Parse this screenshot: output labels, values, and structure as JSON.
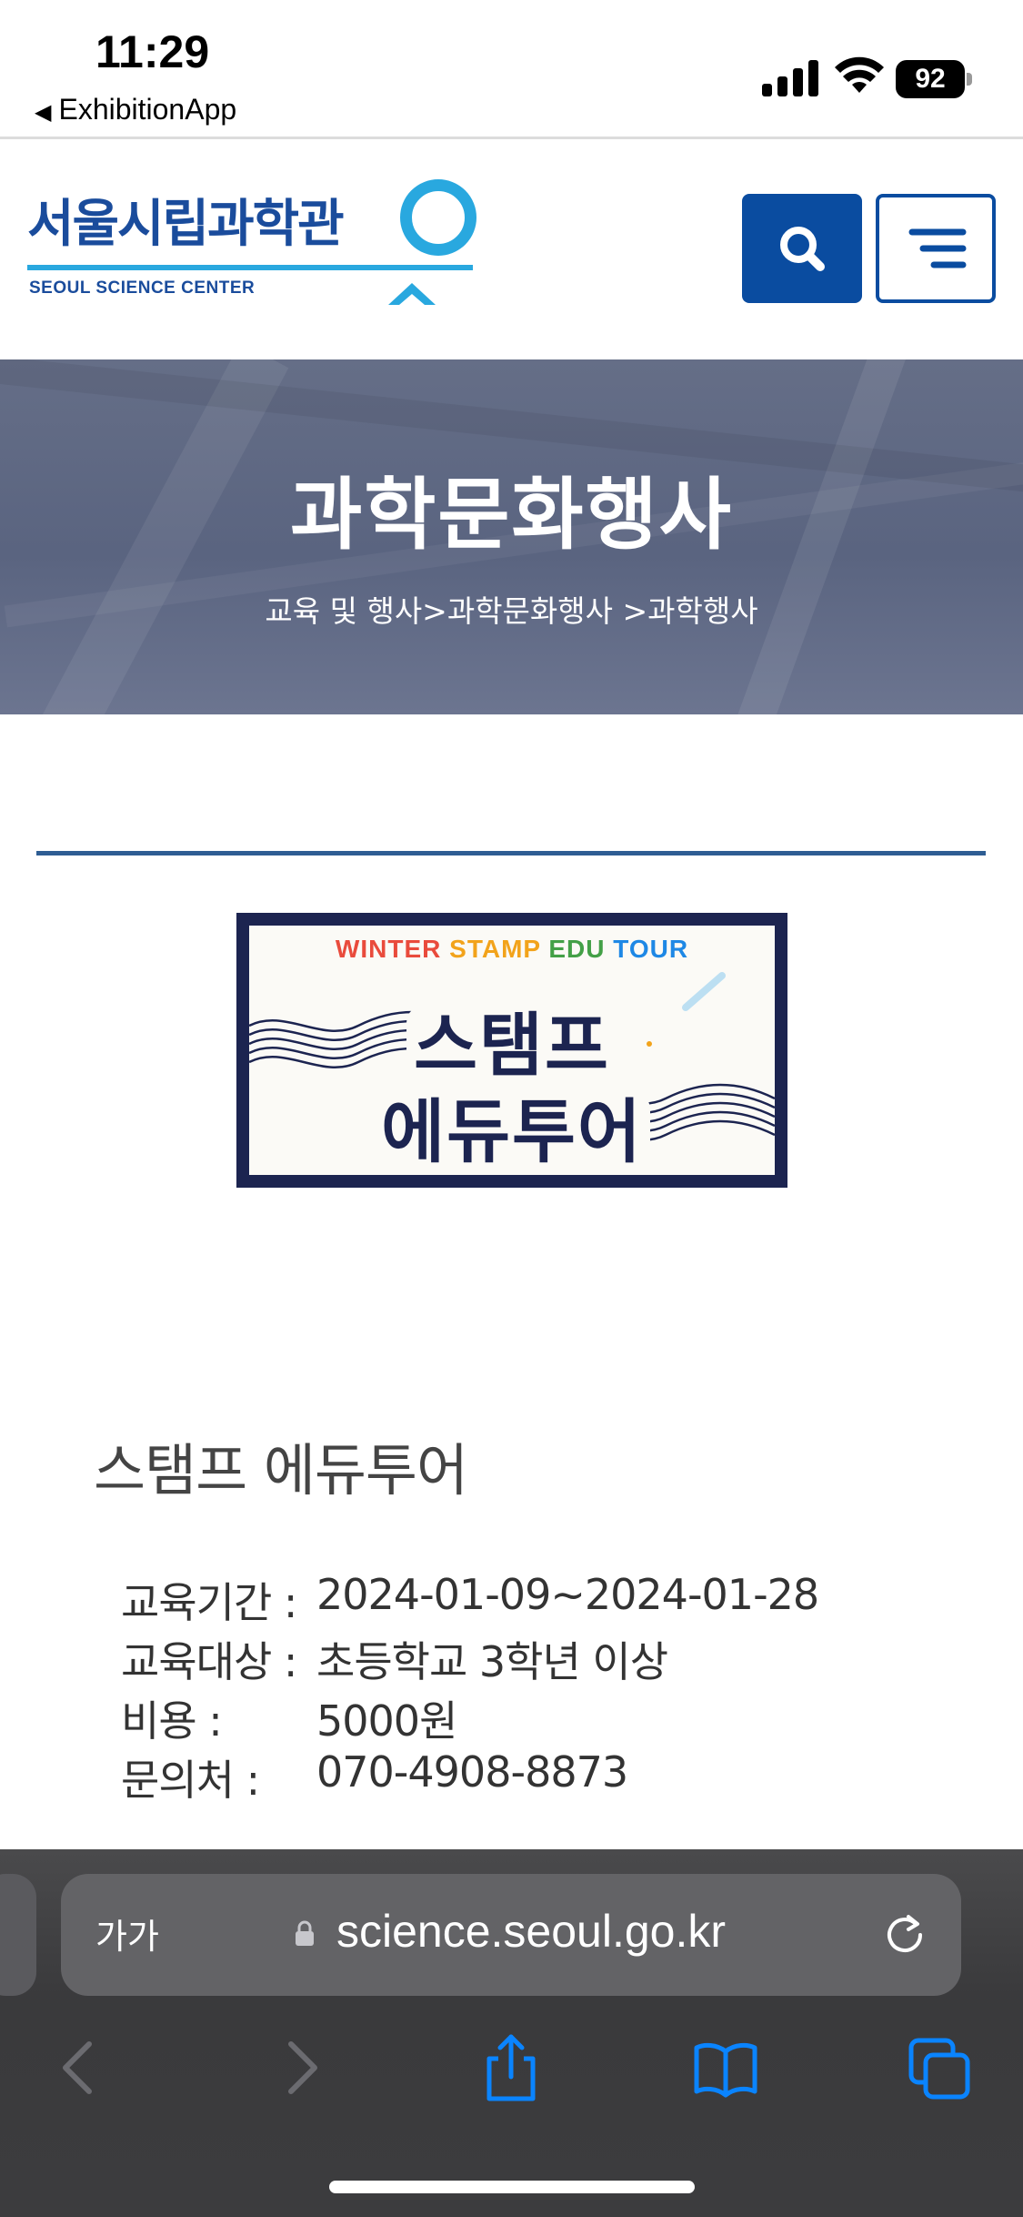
{
  "status_bar": {
    "time": "11:29",
    "back_app": "ExhibitionApp",
    "battery": "92"
  },
  "header": {
    "logo_kr": "서울시립과학관",
    "logo_en": "SEOUL SCIENCE CENTER",
    "search_icon": "search-icon",
    "menu_icon": "menu-icon"
  },
  "banner": {
    "title": "과학문화행사",
    "breadcrumb": "교육 및 행사>과학문화행사 >과학행사"
  },
  "poster": {
    "subtitle_parts": [
      "WINTER ",
      "STAMP ",
      "EDU ",
      "TOUR"
    ],
    "title_line1": "스탬프",
    "title_line2": "에듀투어"
  },
  "event": {
    "title": "스탬프 에듀투어",
    "details": [
      {
        "label": "교육기간 :",
        "value": "2024-01-09~2024-01-28"
      },
      {
        "label": "교육대상 :",
        "value": "초등학교 3학년 이상"
      },
      {
        "label": "비용 :",
        "value": "5000원"
      },
      {
        "label": "문의처 :",
        "value": "070-4908-8873"
      }
    ]
  },
  "browser": {
    "text_size_label": "가가",
    "url": "science.seoul.go.kr",
    "colors": {
      "chrome": "#3a3a3c",
      "accent": "#0a84ff"
    }
  }
}
